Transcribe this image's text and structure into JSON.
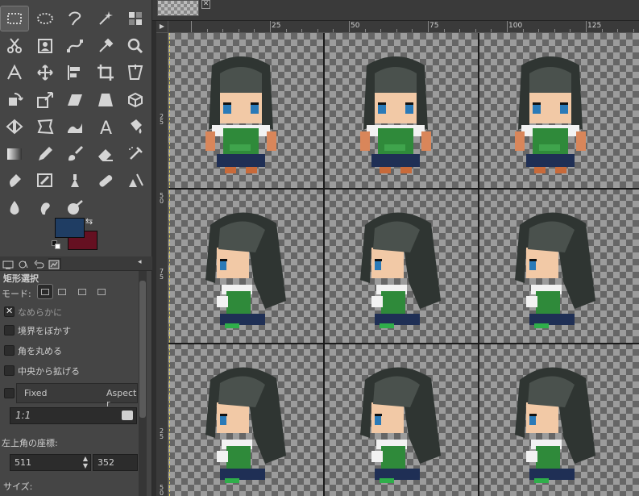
{
  "tool_options": {
    "title": "矩形選択",
    "mode_label": "モード:",
    "antialias_label": "なめらかに",
    "antialias_checked": true,
    "feather_label": "境界をぼかす",
    "round_label": "角を丸める",
    "center_label": "中央から拡げる",
    "fixed_label": "Fixed",
    "fixed_mode": "Aspect r",
    "ratio_value": "1:1",
    "position_label": "左上角の座標:",
    "pos_x": "511",
    "pos_y": "352",
    "size_label": "サイズ:"
  },
  "colors": {
    "foreground": "#1f3d63",
    "background": "#651021"
  },
  "ruler": {
    "h_labels": [
      "25",
      "50",
      "75",
      "100",
      "125"
    ],
    "v_labels": [
      "2\n5",
      "5\n0",
      "7\n5",
      "2\n5",
      "5\n0"
    ]
  },
  "tools": [
    "rect-select-icon",
    "ellipse-select-icon",
    "free-select-icon",
    "fuzzy-select-icon",
    "select-by-color-icon",
    "scissors-icon",
    "foreground-select-icon",
    "paths-icon",
    "color-picker-icon",
    "zoom-icon",
    "measure-icon",
    "move-icon",
    "align-icon",
    "crop-icon",
    "unified-transform-icon",
    "rotate-icon",
    "scale-icon",
    "shear-icon",
    "perspective-icon",
    "3d-transform-icon",
    "flip-icon",
    "cage-icon",
    "warp-icon",
    "text-icon",
    "bucket-fill-icon",
    "gradient-icon",
    "pencil-icon",
    "paintbrush-icon",
    "eraser-icon",
    "airbrush-icon",
    "ink-icon",
    "mypaint-brush-icon",
    "clone-icon",
    "heal-icon",
    "perspective-clone-icon",
    "blur-icon",
    "smudge-icon",
    "dodge-burn-icon"
  ]
}
